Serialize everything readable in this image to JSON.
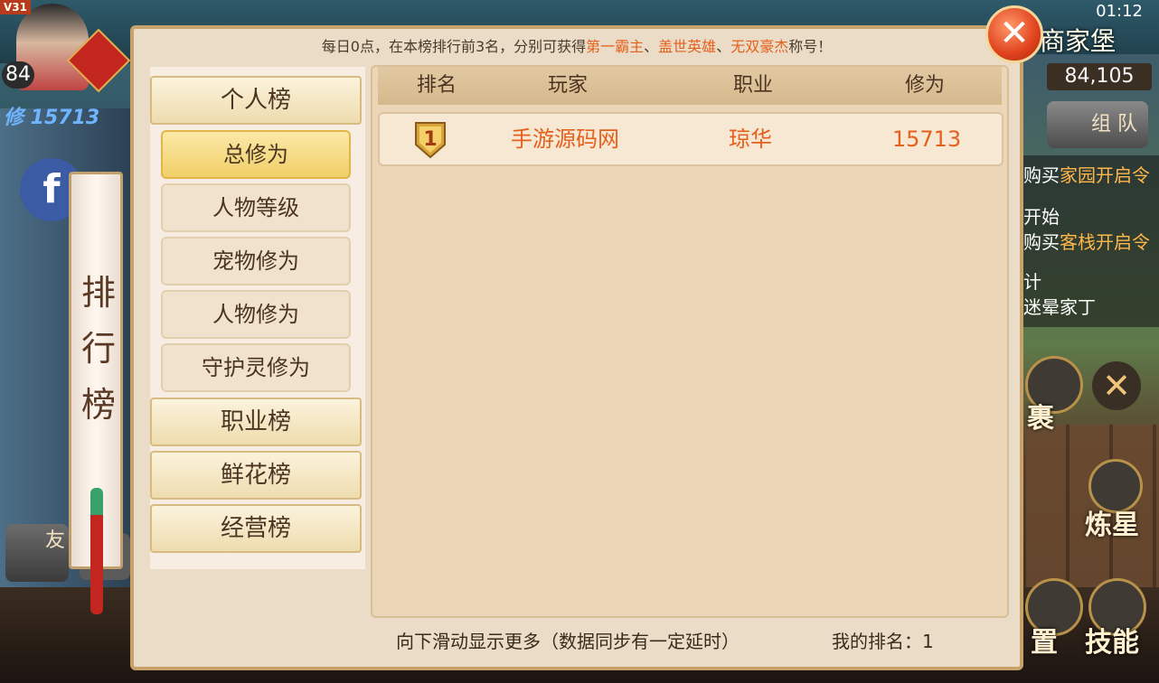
{
  "hud": {
    "version": "V31",
    "level": "84",
    "cultivation": "修 15713",
    "friend_label": "友",
    "status_time": "01:12",
    "location": "商家堡",
    "coords": "84,105",
    "team_label": "组 队",
    "tasks": [
      {
        "prefix": "购买",
        "highlight": "家园开启令"
      },
      {
        "prefix": "开始",
        "highlight": ""
      },
      {
        "prefix": "购买",
        "highlight": "客栈开启令"
      },
      {
        "prefix": "计",
        "highlight": ""
      },
      {
        "prefix": "迷晕家丁",
        "highlight": ""
      }
    ],
    "bag_label": "裹",
    "refine_label": "炼星",
    "settings_label": "置",
    "skills_label": "技能"
  },
  "scroll_title": "排行榜",
  "notice": {
    "prefix": "每日0点，在本榜排行前3名，分别可获得",
    "title1": "第一霸主",
    "sep1": "、",
    "title2": "盖世英雄",
    "sep2": "、",
    "title3": "无双豪杰",
    "suffix": "称号！"
  },
  "tabs": {
    "personal": "个人榜",
    "sub": [
      "总修为",
      "人物等级",
      "宠物修为",
      "人物修为",
      "守护灵修为"
    ],
    "active_sub": 0,
    "career": "职业榜",
    "flowers": "鲜花榜",
    "business": "经营榜"
  },
  "table": {
    "headers": [
      "排名",
      "玩家",
      "职业",
      "修为"
    ],
    "rows": [
      {
        "rank": "1",
        "player": "手游源码网",
        "profession": "琼华",
        "cultivation": "15713"
      }
    ]
  },
  "footer": {
    "hint": "向下滑动显示更多（数据同步有一定延时）",
    "my_rank": "我的排名：1"
  },
  "colors": {
    "highlight": "#e5601d",
    "panel_bg": "#eadcc7",
    "active_tab": "#f1cf68"
  }
}
